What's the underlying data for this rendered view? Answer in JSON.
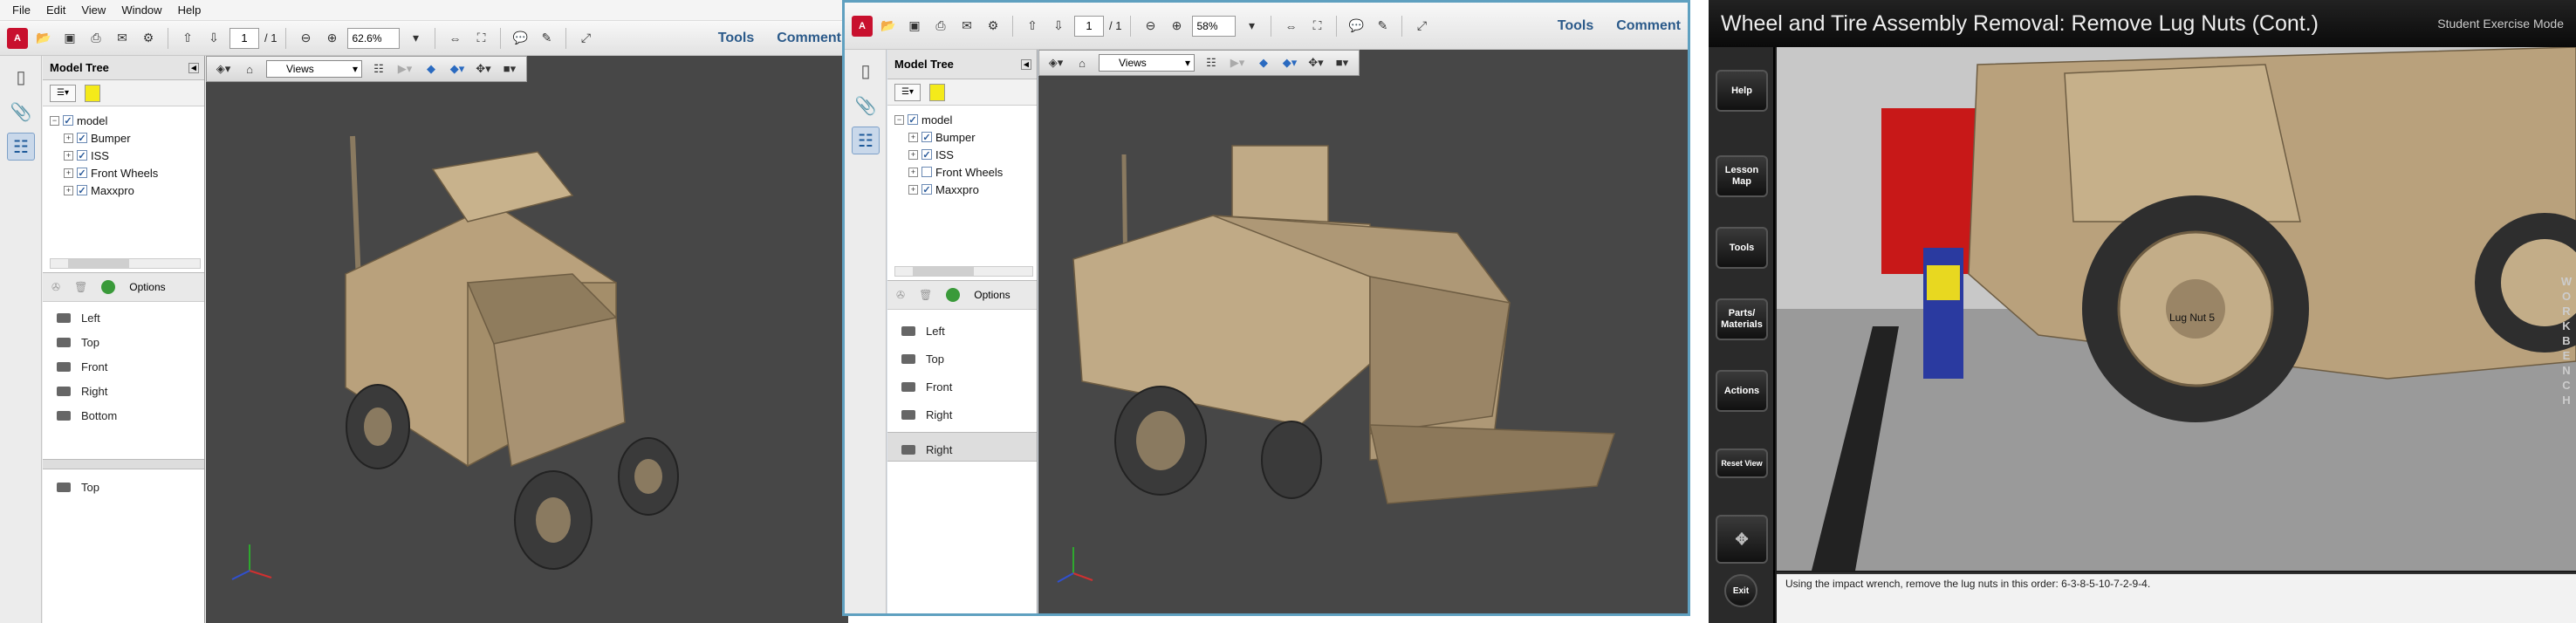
{
  "panel1": {
    "menu": [
      "File",
      "Edit",
      "View",
      "Window",
      "Help"
    ],
    "page_current": "1",
    "page_total": "/ 1",
    "zoom": "62.6%",
    "links": [
      "Tools",
      "Comment"
    ],
    "tree_title": "Model Tree",
    "tree_root": "model",
    "tree_items": [
      "Bumper",
      "ISS",
      "Front Wheels",
      "Maxxpro"
    ],
    "views_options": "Options",
    "views": [
      "Left",
      "Top",
      "Front",
      "Right",
      "Bottom"
    ],
    "selected_view": "Top",
    "views_dropdown": "Views"
  },
  "panel2": {
    "page_current": "1",
    "page_total": "/ 1",
    "zoom": "58%",
    "links": [
      "Tools",
      "Comment"
    ],
    "tree_title": "Model Tree",
    "tree_root": "model",
    "tree_items": [
      "Bumper",
      "ISS",
      "Front Wheels",
      "Maxxpro"
    ],
    "views_options": "Options",
    "views": [
      "Left",
      "Top",
      "Front",
      "Right"
    ],
    "selected_view": "Right",
    "views_dropdown": "Views"
  },
  "panel3": {
    "title": "Wheel and Tire Assembly Removal: Remove Lug Nuts (Cont.)",
    "mode": "Student Exercise Mode",
    "buttons": [
      "Help",
      "Lesson Map",
      "Tools",
      "Parts/ Materials",
      "Actions"
    ],
    "reset_view": "Reset View",
    "exit": "Exit",
    "workbench": "WORKBENCH",
    "lug_label": "Lug Nut 5",
    "instruction": "Using the impact wrench, remove the lug nuts in this order: 6-3-8-5-10-7-2-9-4."
  },
  "colors": {
    "accent_red": "#c8102e",
    "link_blue": "#2b5a8a",
    "viewer_bg": "#474747",
    "truck_tan": "#b9a17c"
  }
}
